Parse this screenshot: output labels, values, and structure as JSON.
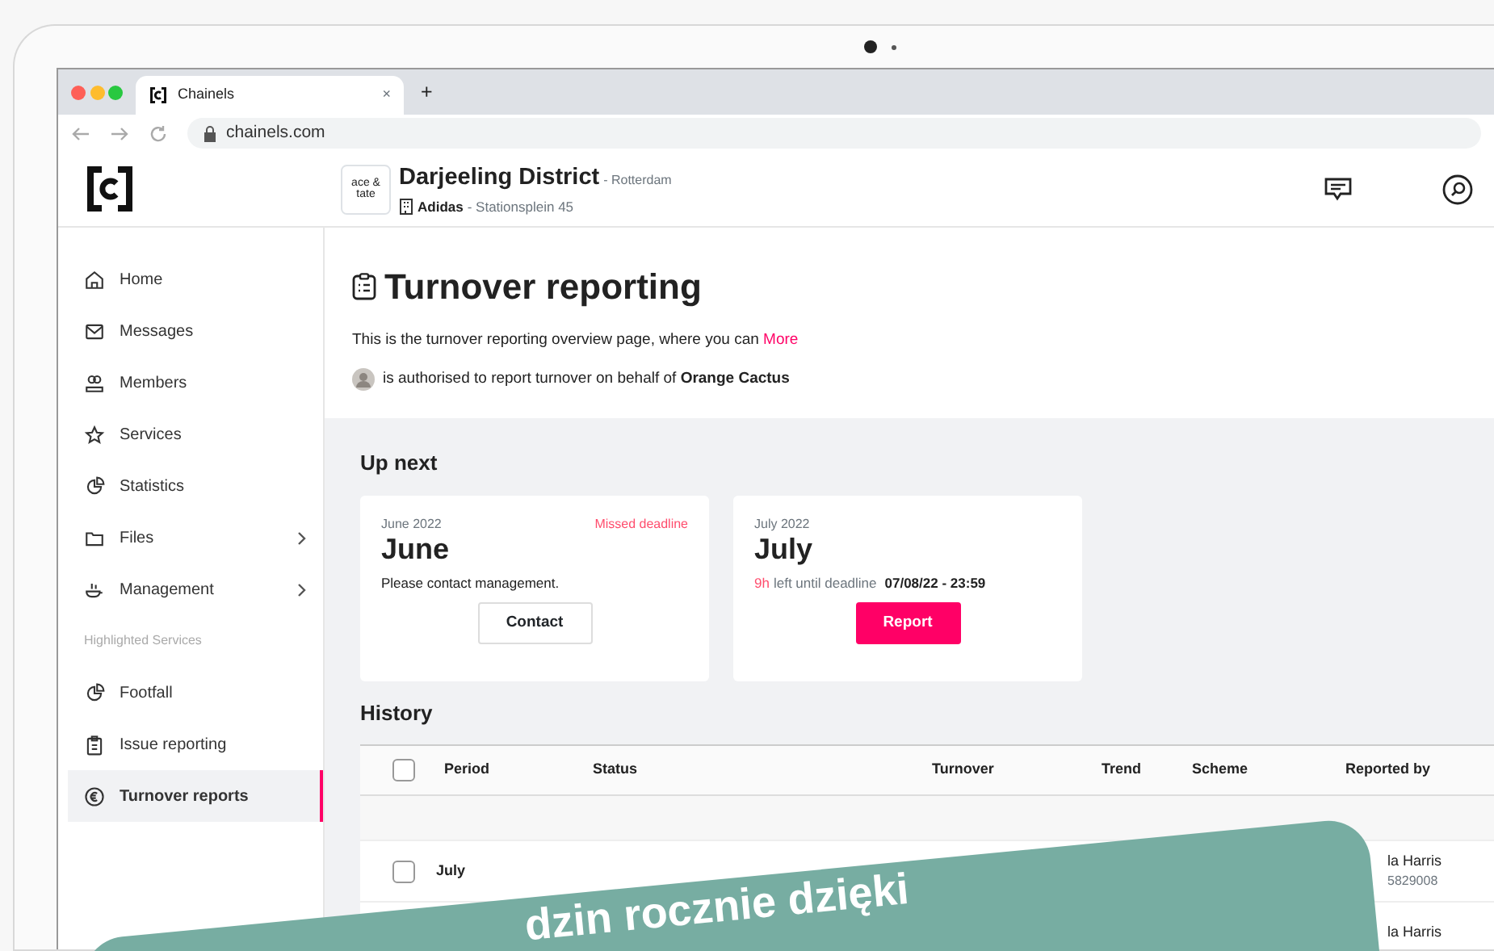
{
  "browser": {
    "tab_title": "Chainels",
    "new_tab": "+",
    "close_tab": "×",
    "url": "chainels.com"
  },
  "header": {
    "brand": "ace & tate",
    "title": "Darjeeling District",
    "city": "- Rotterdam",
    "company": "Adidas",
    "address": "- Stationsplein 45"
  },
  "sidebar": {
    "items": [
      {
        "kind": "item",
        "label": "Home",
        "selected": false,
        "expandable": false
      },
      {
        "kind": "item",
        "label": "Messages",
        "selected": false,
        "expandable": false
      },
      {
        "kind": "item",
        "label": "Members",
        "selected": false,
        "expandable": false
      },
      {
        "kind": "item",
        "label": "Services",
        "selected": false,
        "expandable": false
      },
      {
        "kind": "item",
        "label": "Statistics",
        "selected": false,
        "expandable": false
      },
      {
        "kind": "item",
        "label": "Files",
        "selected": false,
        "expandable": true
      },
      {
        "kind": "item",
        "label": "Management",
        "selected": false,
        "expandable": true
      },
      {
        "kind": "section",
        "label": "Highlighted Services"
      },
      {
        "kind": "item",
        "label": "Footfall",
        "selected": false,
        "expandable": false
      },
      {
        "kind": "item",
        "label": "Issue reporting",
        "selected": false,
        "expandable": false
      },
      {
        "kind": "item",
        "label": "Turnover reports",
        "selected": true,
        "expandable": false
      }
    ]
  },
  "page": {
    "title": "Turnover reporting",
    "intro": "This is the turnover reporting overview page, where you can",
    "intro_link": "More",
    "authorised": "is authorised to report turnover on behalf of **Orange Cactus**"
  },
  "up_next": {
    "heading": "Up next",
    "cards": [
      {
        "period": "June 2022",
        "month": "June",
        "flag": "Missed deadline",
        "message": "Please contact management.",
        "button": "Contact",
        "primary": false
      },
      {
        "period": "July 2022",
        "month": "July",
        "time_left": "9h",
        "deadline_label": "left until deadline",
        "deadline": "07/08/22 - 23:59",
        "button": "Report",
        "primary": true
      }
    ]
  },
  "history": {
    "heading": "History",
    "header_checked": false,
    "columns": [
      "Period",
      "Status",
      "Turnover",
      "Trend",
      "Scheme",
      "Reported by"
    ],
    "rows": [
      {
        "checked": false,
        "period": "July",
        "reporter": "la Harris",
        "reporter_id": "5829008"
      },
      {
        "reporter": "la Harris"
      }
    ]
  },
  "banner": {
    "text": "dzin rocznie dzięki"
  }
}
